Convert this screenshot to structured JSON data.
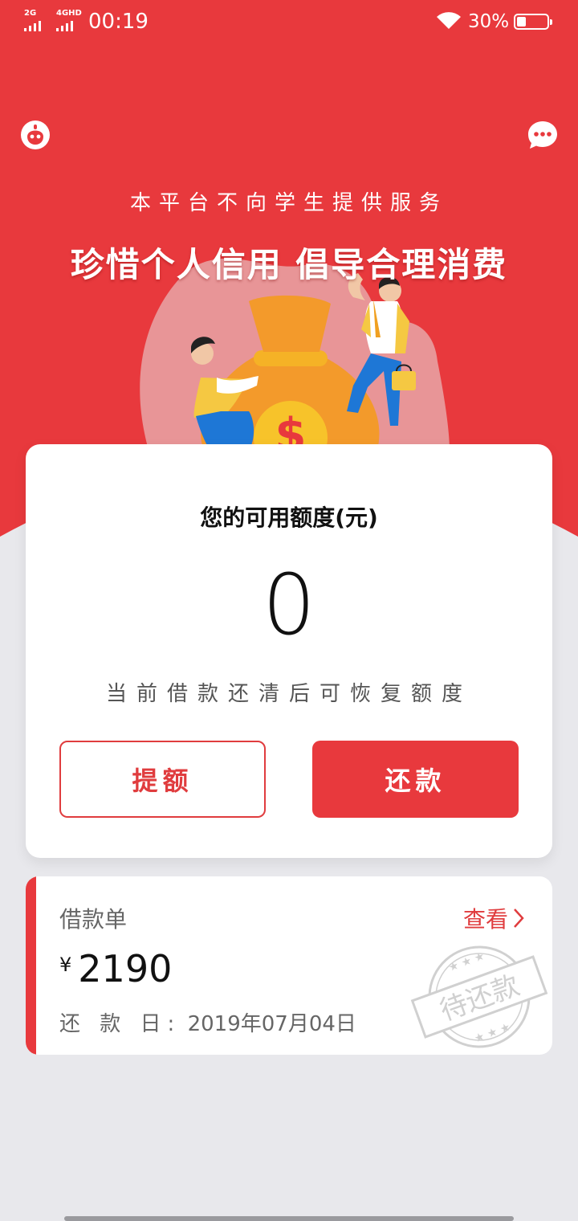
{
  "status_bar": {
    "network_1": "2G",
    "network_2": "4GHD",
    "time": "00:19",
    "battery_percent": "30%",
    "battery_level": 0.3
  },
  "header": {
    "left_icon": "robot-service-icon",
    "right_icon": "chat-bubble-icon",
    "notice": "本平台不向学生提供服务",
    "slogan": "珍惜个人信用 倡导合理消费"
  },
  "credit": {
    "title": "您的可用额度(元)",
    "amount": "0",
    "hint": "当前借款还清后可恢复额度",
    "raise_button": "提额",
    "repay_button": "还款"
  },
  "loan": {
    "title": "借款单",
    "view_label": "查看",
    "currency": "¥",
    "amount": "2190",
    "due_label": "还 款 日:",
    "due_date": "2019年07月04日",
    "stamp_text": "待还款"
  },
  "colors": {
    "primary": "#e8393d",
    "background": "#e8e8ec"
  }
}
